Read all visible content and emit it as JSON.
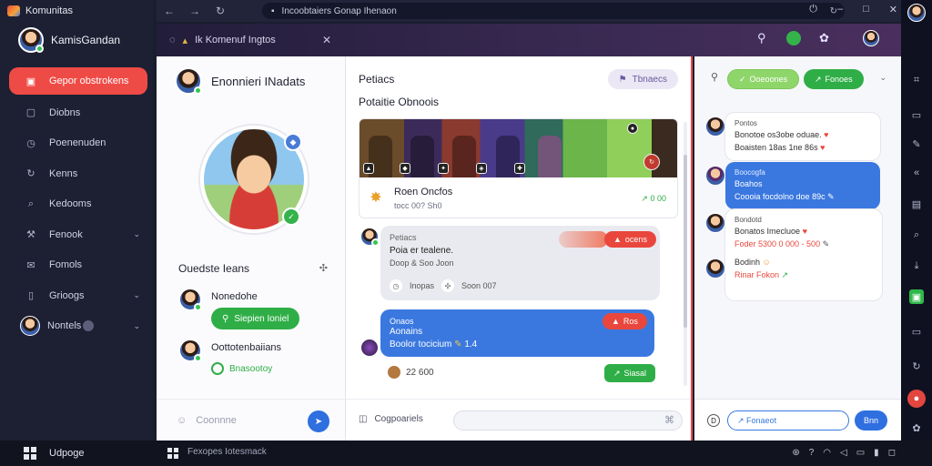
{
  "app": {
    "brand": "Komunitas",
    "user": "KamisGandan"
  },
  "sidebar": {
    "items": [
      {
        "label": "Gepor obstrokens",
        "icon": "calendar-icon",
        "active": true
      },
      {
        "label": "Diobns",
        "icon": "document-icon"
      },
      {
        "label": "Poenenuden",
        "icon": "clock-icon"
      },
      {
        "label": "Kenns",
        "icon": "refresh-icon"
      },
      {
        "label": "Kedooms",
        "icon": "search-icon"
      },
      {
        "label": "Fenook",
        "icon": "wrench-icon",
        "chevron": true
      },
      {
        "label": "Fomols",
        "icon": "envelope-icon"
      },
      {
        "label": "Grioogs",
        "icon": "square-icon",
        "chevron": true
      },
      {
        "label": "Nontels",
        "icon": "avatar",
        "chevron": true
      }
    ],
    "footer": "Udpoge"
  },
  "browser": {
    "url": "Incoobtaiers Gonap Ihenaon",
    "tab_title": "Ik Komenuf Ingtos"
  },
  "profile": {
    "name": "Enonnieri INadats",
    "section_title": "Ouedste Ieans",
    "contacts": [
      {
        "name": "Nonedohe",
        "action": "Siepien Ioniel"
      },
      {
        "name": "Oottotenbaiians",
        "action": "Bnasootoy"
      }
    ],
    "composer_placeholder": "Coonnne"
  },
  "feed": {
    "title": "Petiacs",
    "subtitle": "Potaitie Obnoois",
    "tag": "Tbnaecs",
    "card": {
      "title": "Roen Oncfos",
      "subtitle": "tocc 00?   Sh0",
      "meta": "0 00"
    },
    "msg1": {
      "author": "Petiacs",
      "line1": "Poia er tealene.",
      "line2": "Doop & Soo Joon",
      "time1": "Inopas",
      "time2": "Soon 007",
      "pill": "ocens"
    },
    "msg2": {
      "author": "Onaos",
      "line1": "Aonains",
      "line2": "Boolor tocicium",
      "line2b": "1.4",
      "pill": "Ros"
    },
    "reactions": "22 600",
    "button": "Siasal",
    "composer_label": "Cogpoariels"
  },
  "chat": {
    "pill1": "Ooeoones",
    "pill2": "Fonoes",
    "bubbles": [
      {
        "name": "Pontos",
        "l1": "Bonotoe os3obe oduae.",
        "l2": "Boaisten 18as 1ne 86s"
      },
      {
        "name": "Boocogfa",
        "l1": "Boahos",
        "l2": "Coooia focdolno doe 89c"
      },
      {
        "name": "Bondotd",
        "l1": "Bonatos  Imecluoe",
        "l2": "Foder  5300   0 000 - 500"
      },
      {
        "name": "Bodinh",
        "l1": "Rinar Fokon"
      }
    ],
    "input": "Fonaeot",
    "send": "Bnn"
  },
  "taskbar": {
    "search": "Fexopes Iotesmack",
    "label": "Udpoge"
  },
  "colors": {
    "accent": "#ef4b46",
    "green": "#2fae47",
    "blue": "#3a78e0"
  }
}
